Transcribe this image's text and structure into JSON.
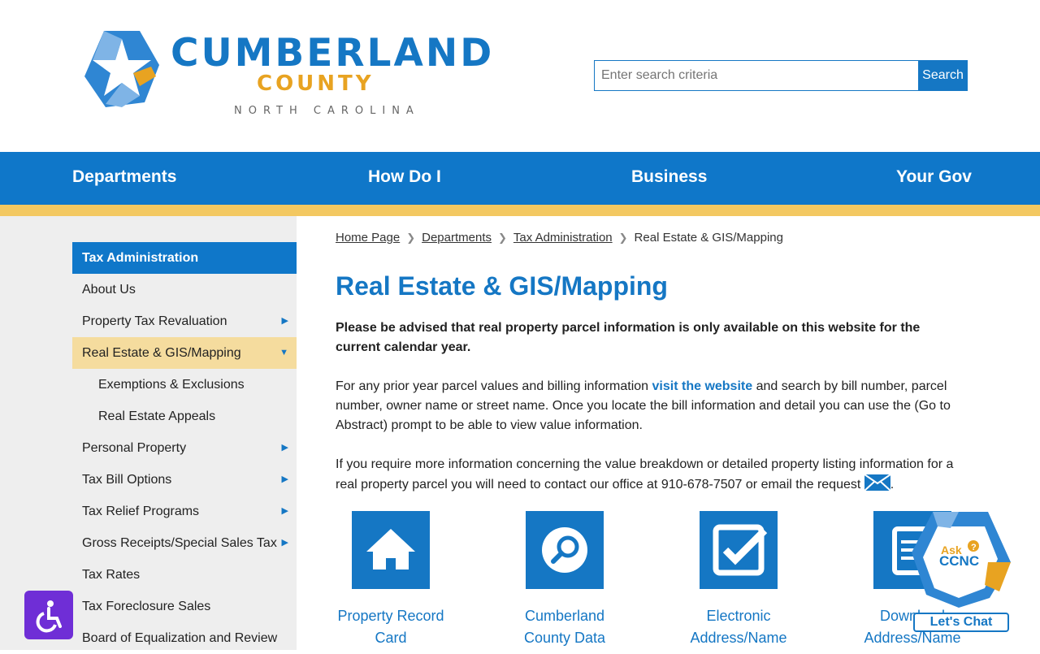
{
  "logo": {
    "line1": "CUMBERLAND",
    "line2": "COUNTY",
    "line3": "NORTH CAROLINA"
  },
  "search": {
    "placeholder": "Enter search criteria",
    "button": "Search"
  },
  "nav": {
    "items": [
      "Departments",
      "How Do I",
      "Business",
      "Your Gov"
    ]
  },
  "sidebar": {
    "heading": "Tax Administration",
    "items": [
      "About Us",
      "Property Tax Revaluation",
      "Real Estate & GIS/Mapping",
      "Exemptions & Exclusions",
      "Real Estate Appeals",
      "Personal Property",
      "Tax Bill Options",
      "Tax Relief Programs",
      "Gross Receipts/Special Sales Tax",
      "Tax Rates",
      "Tax Foreclosure Sales",
      "Board of Equalization and Review"
    ]
  },
  "breadcrumb": [
    "Home Page",
    "Departments",
    "Tax Administration",
    "Real Estate & GIS/Mapping"
  ],
  "page_title": "Real Estate & GIS/Mapping",
  "notice": "Please be advised that real property parcel information is only available on this website for the current calendar year.",
  "para1": {
    "before": "For any prior year parcel values and billing information ",
    "link": "visit the website",
    "after": " and search by bill number, parcel number, owner name or street name. Once you locate the bill information and detail you can use the (Go to Abstract) prompt to be able to view value information."
  },
  "para2": {
    "text": "If you require more information concerning the value breakdown or detailed property listing information for a real property parcel you will need to contact our office at 910-678-7507 or email the request",
    "end": "."
  },
  "tiles": [
    {
      "line1": "Property Record",
      "line2": "Card",
      "icon": "home-icon"
    },
    {
      "line1": "Cumberland",
      "line2": "County Data",
      "icon": "search-icon"
    },
    {
      "line1": "Electronic",
      "line2": "Address/Name",
      "icon": "checkbox-icon"
    },
    {
      "line1": "Download",
      "line2": "Address/Name",
      "icon": "document-icon"
    }
  ],
  "chat": {
    "ask": "Ask",
    "brand": "CCNC",
    "button": "Let's Chat"
  },
  "colors": {
    "primary": "#1577c4",
    "gold": "#f3c861",
    "active": "#f5dc9e",
    "accessibility": "#6f2ed6"
  }
}
